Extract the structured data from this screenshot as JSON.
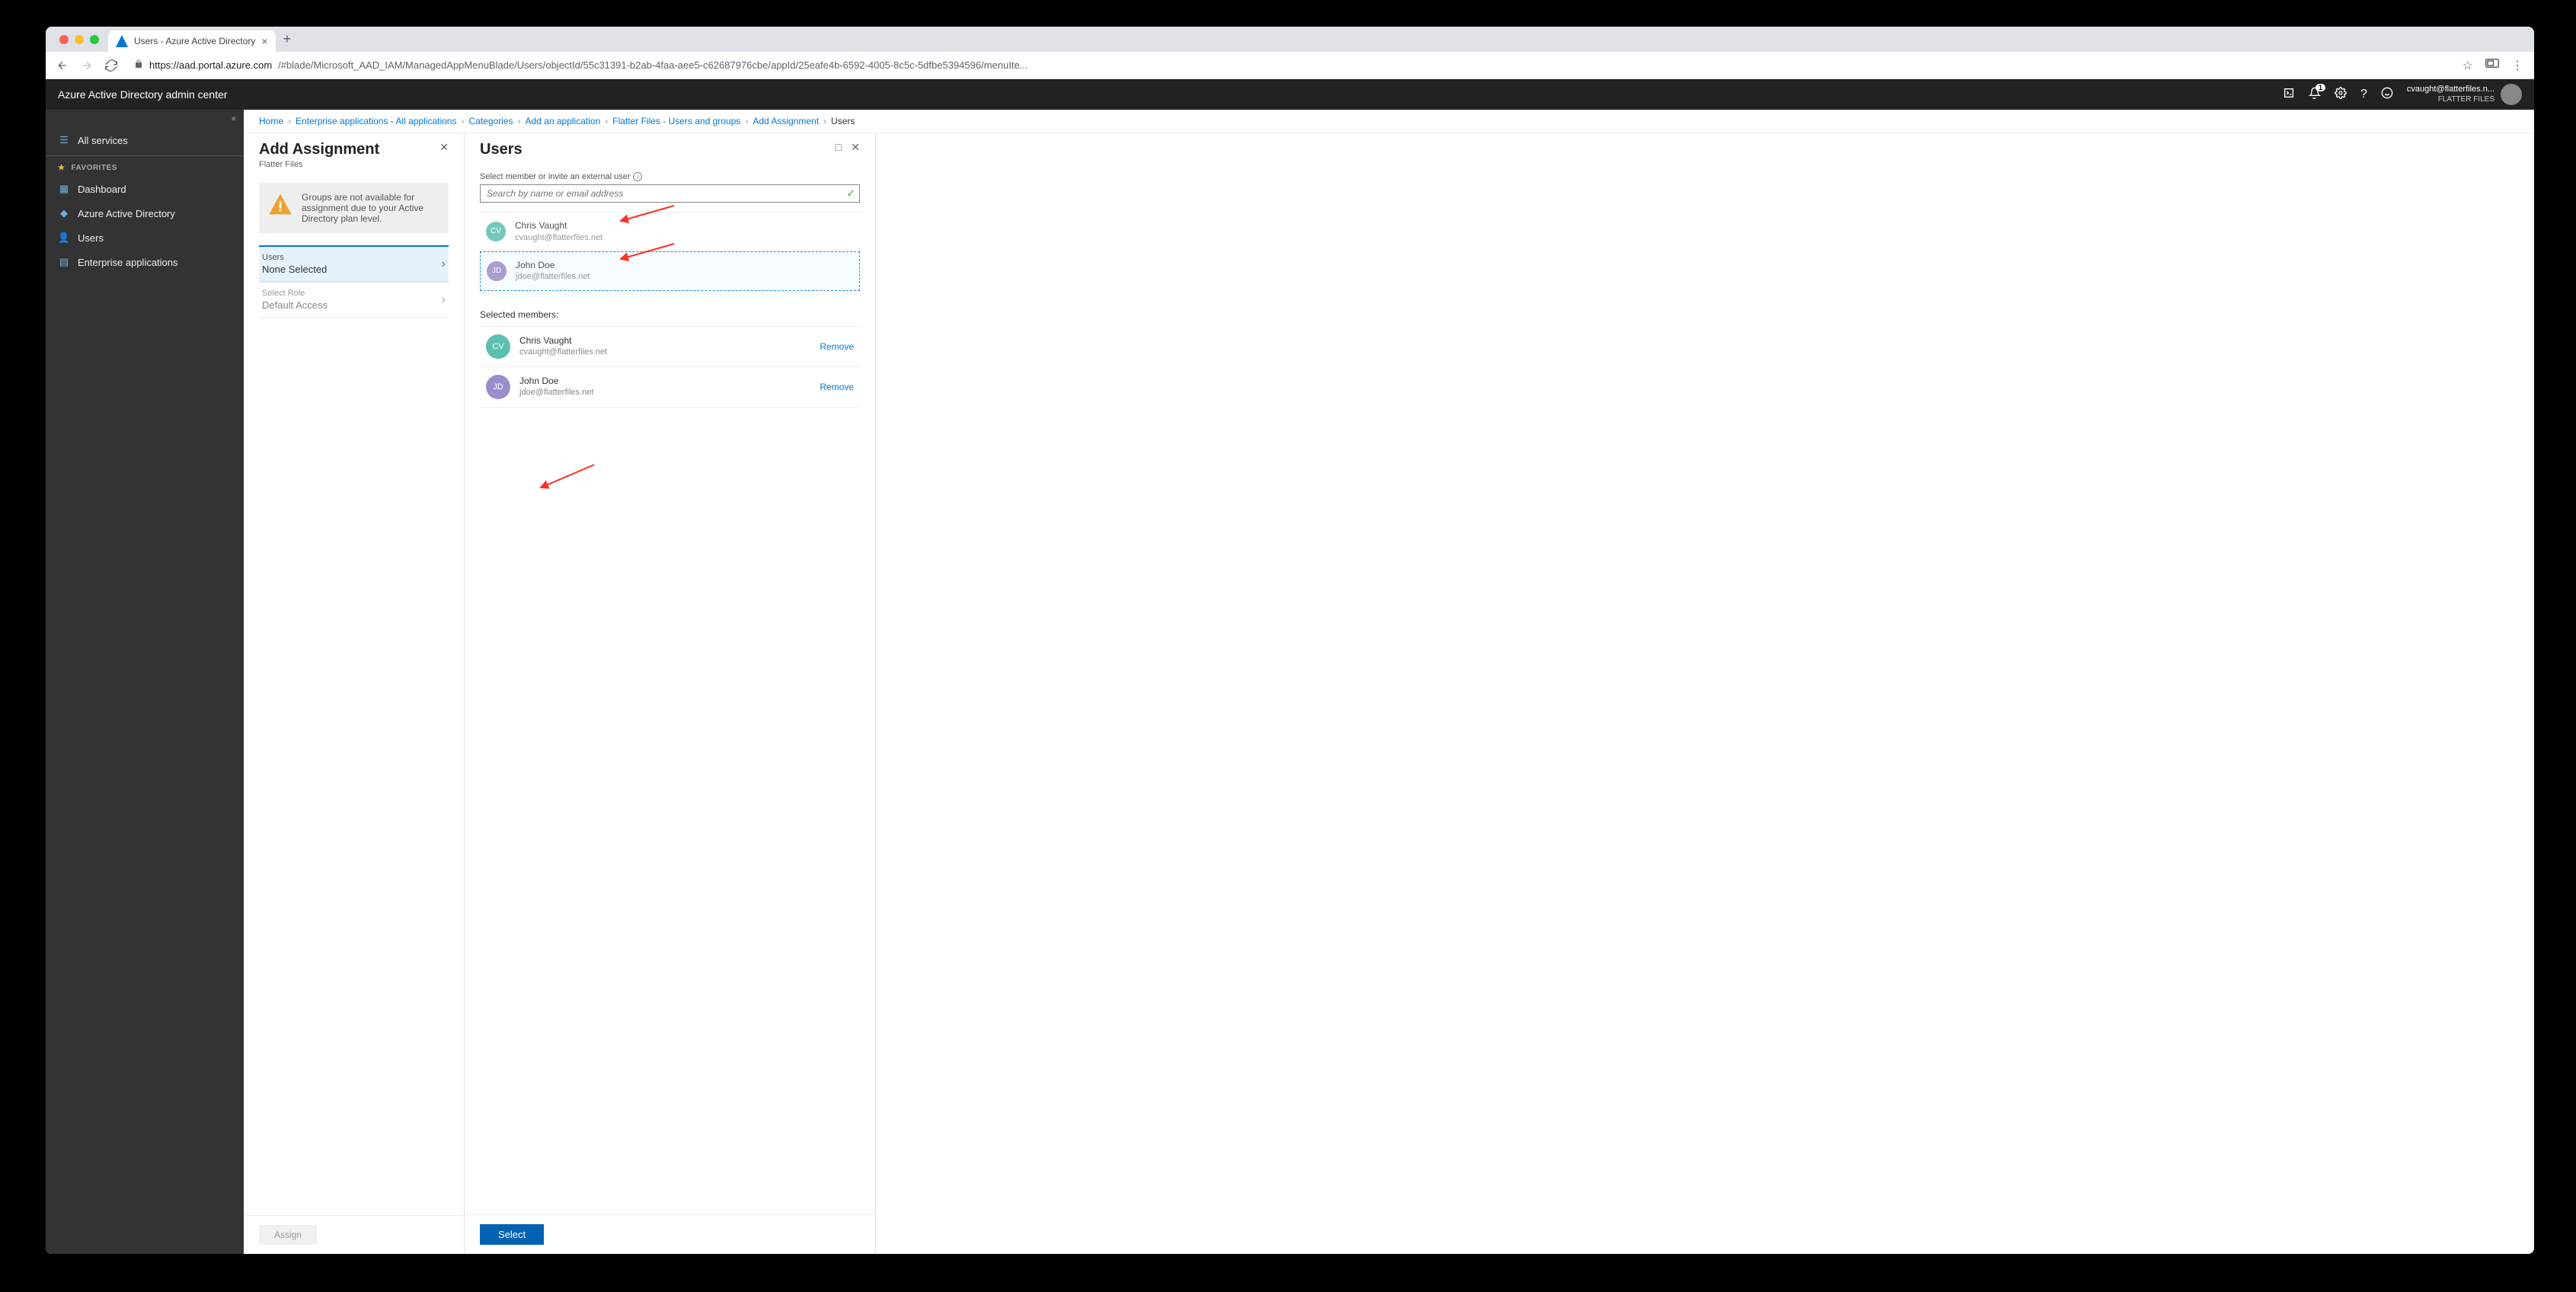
{
  "browser": {
    "tab_title": "Users - Azure Active Directory",
    "url_host": "https://aad.portal.azure.com",
    "url_path": "/#blade/Microsoft_AAD_IAM/ManagedAppMenuBlade/Users/objectId/55c31391-b2ab-4faa-aee5-c62687976cbe/appId/25eafe4b-6592-4005-8c5c-5dfbe5394596/menuIte..."
  },
  "header": {
    "title": "Azure Active Directory admin center",
    "notification_count": "1",
    "user_email": "cvaught@flatterfiles.n...",
    "tenant": "FLATTER FILES"
  },
  "sidebar": {
    "all_services": "All services",
    "favorites": "FAVORITES",
    "dashboard": "Dashboard",
    "aad": "Azure Active Directory",
    "users": "Users",
    "ent_apps": "Enterprise applications"
  },
  "breadcrumb": {
    "home": "Home",
    "ent_apps": "Enterprise applications - All applications",
    "categories": "Categories",
    "add_app": "Add an application",
    "flatter": "Flatter Files - Users and groups",
    "assign": "Add Assignment",
    "current": "Users"
  },
  "blade1": {
    "title": "Add Assignment",
    "subtitle": "Flatter Files",
    "warning": "Groups are not available for assignment due to your Active Directory plan level.",
    "users_label": "Users",
    "users_value": "None Selected",
    "role_label": "Select Role",
    "role_value": "Default Access",
    "assign": "Assign"
  },
  "blade2": {
    "title": "Users",
    "search_label": "Select member or invite an external user",
    "search_placeholder": "Search by name or email address",
    "suggestions": [
      {
        "initials": "CV",
        "name": "Chris Vaught",
        "email": "cvaught@flatterfiles.net",
        "avatar": "av-cv",
        "selected": false
      },
      {
        "initials": "JD",
        "name": "John Doe",
        "email": "jdoe@flatterfiles.net",
        "avatar": "av-jd",
        "selected": true
      }
    ],
    "selected_label": "Selected members:",
    "selected": [
      {
        "initials": "CV",
        "name": "Chris Vaught",
        "email": "cvaught@flatterfiles.net",
        "avatar": "av-cv"
      },
      {
        "initials": "JD",
        "name": "John Doe",
        "email": "jdoe@flatterfiles.net",
        "avatar": "av-jd"
      }
    ],
    "remove": "Remove",
    "select": "Select"
  }
}
